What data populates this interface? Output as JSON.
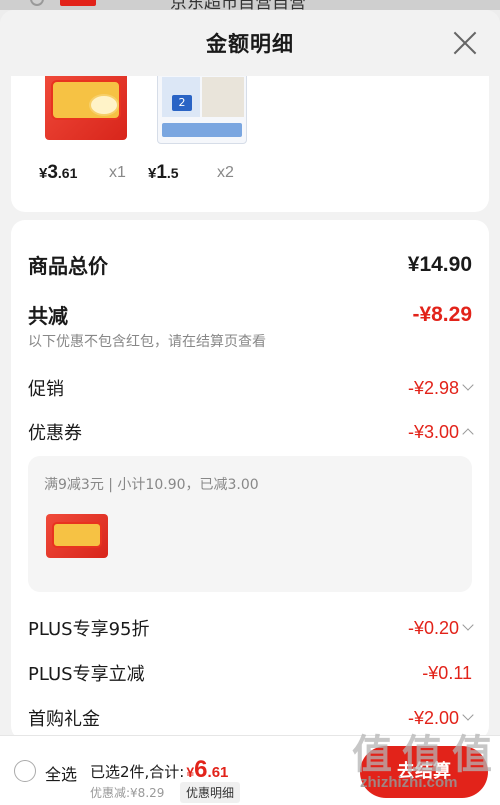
{
  "underlay": {
    "text": "京东超市自营自营"
  },
  "sheet": {
    "title": "金额明细"
  },
  "goods": [
    {
      "price_currency": "¥",
      "price_int": "3",
      "price_dec": ".61",
      "qty": "x1"
    },
    {
      "price_currency": "¥",
      "price_int": "1",
      "price_dec": ".5",
      "qty": "x2"
    }
  ],
  "summary": {
    "total_label": "商品总价",
    "total_amount": "¥14.90",
    "reduce_label": "共减",
    "reduce_amount": "-¥8.29",
    "reduce_note": "以下优惠不包含红包，请在结算页查看",
    "promo_label": "促销",
    "promo_amount": "-¥2.98",
    "coupon_label": "优惠券",
    "coupon_amount": "-¥3.00",
    "coupon_detail": "满9减3元 | 小计10.90，已减3.00",
    "plus95_label": "PLUS专享95折",
    "plus95_amount": "-¥0.20",
    "plus_instant_label": "PLUS专享立减",
    "plus_instant_amount": "-¥0.11",
    "first_gift_label": "首购礼金",
    "first_gift_amount": "-¥2.00"
  },
  "bottom": {
    "select_all": "全选",
    "selected_text": "已选2件,合计:",
    "total_currency": "¥",
    "total_int": "6",
    "total_dec": ".61",
    "discount_text": "优惠减:¥8.29",
    "detail_link": "优惠明细",
    "checkout": "去结算"
  },
  "watermark": {
    "chars": [
      "值",
      "值",
      "值"
    ],
    "url": "zhizhizhi.com"
  },
  "colors": {
    "accent": "#e2231a",
    "muted": "#888888"
  }
}
